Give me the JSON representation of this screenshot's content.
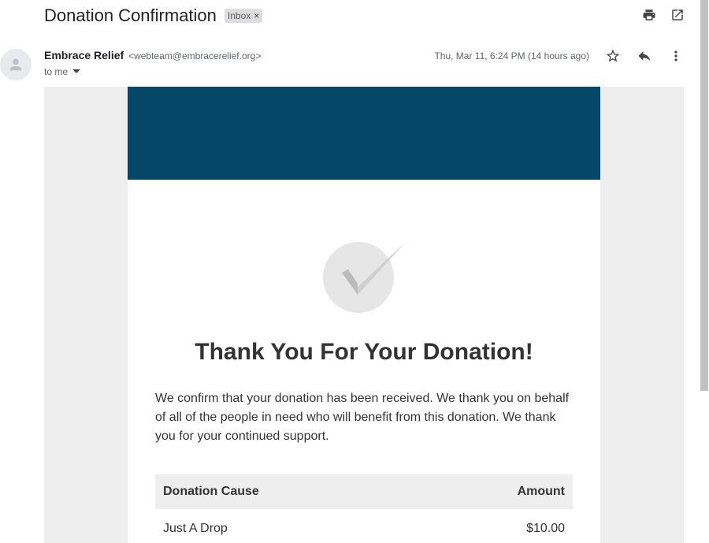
{
  "header": {
    "subject": "Donation Confirmation",
    "label": "Inbox",
    "label_remove": "×",
    "print_icon": "print-icon",
    "popout_icon": "open-in-new-icon"
  },
  "message": {
    "sender_name": "Embrace Relief",
    "sender_email": "<webteam@embracerelief.org>",
    "to": "to me",
    "date": "Thu, Mar 11, 6:24 PM (14 hours ago)",
    "icons": [
      "star-icon",
      "reply-icon",
      "more-vert-icon"
    ]
  },
  "email": {
    "banner_color": "#044767",
    "heading": "Thank You For Your Donation!",
    "body": "We confirm that your donation has been received. We thank you on behalf of all of the people in need who will benefit from this donation. We thank you for your continued support.",
    "table": {
      "headers": [
        "Donation Cause",
        "Amount"
      ],
      "rows": [
        [
          "Just A Drop",
          "$10.00"
        ]
      ]
    }
  }
}
